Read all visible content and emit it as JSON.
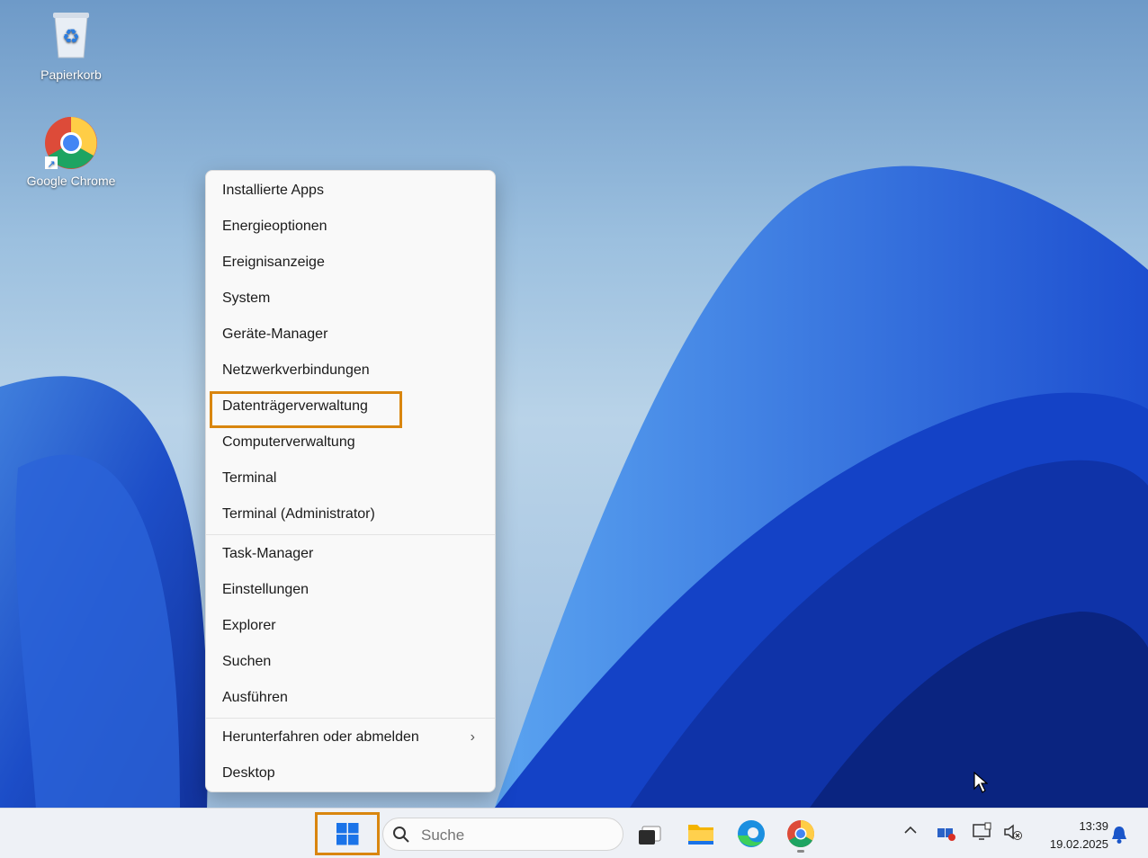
{
  "desktop": {
    "icons": [
      {
        "label": "Papierkorb",
        "icon": "recycle-bin-icon"
      },
      {
        "label": "Google Chrome",
        "icon": "chrome-icon"
      }
    ]
  },
  "context_menu": {
    "group1": [
      {
        "label": "Installierte Apps"
      },
      {
        "label": "Energieoptionen"
      },
      {
        "label": "Ereignisanzeige"
      },
      {
        "label": "System"
      },
      {
        "label": "Geräte-Manager"
      },
      {
        "label": "Netzwerkverbindungen"
      },
      {
        "label": "Datenträgerverwaltung",
        "highlighted": true
      },
      {
        "label": "Computerverwaltung"
      },
      {
        "label": "Terminal"
      },
      {
        "label": "Terminal (Administrator)"
      }
    ],
    "group2": [
      {
        "label": "Task-Manager"
      },
      {
        "label": "Einstellungen"
      },
      {
        "label": "Explorer"
      },
      {
        "label": "Suchen"
      },
      {
        "label": "Ausführen"
      }
    ],
    "group3": [
      {
        "label": "Herunterfahren oder abmelden",
        "submenu": true
      },
      {
        "label": "Desktop"
      }
    ],
    "highlight_color": "#d9860f"
  },
  "taskbar": {
    "search_placeholder": "Suche",
    "pinned": [
      "windows-start-icon",
      "task-view-icon",
      "file-explorer-icon",
      "edge-icon",
      "chrome-icon"
    ],
    "tray_icons": [
      "chevron-up-icon",
      "network-adapter-icon",
      "display-icon",
      "speaker-muted-icon"
    ],
    "time": "13:39",
    "date": "19.02.2025",
    "notification_icon": "bell-icon"
  }
}
